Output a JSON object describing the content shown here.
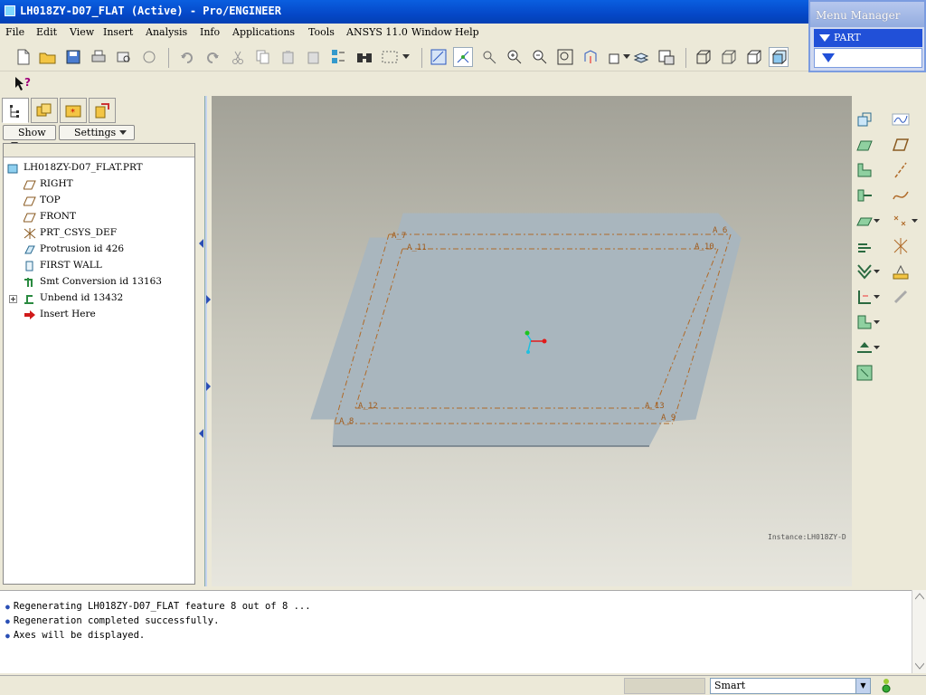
{
  "window": {
    "title": "LH018ZY-D07_FLAT (Active) - Pro/ENGINEER"
  },
  "menubar": {
    "items": [
      "File",
      "Edit",
      "View",
      "Insert",
      "Analysis",
      "Info",
      "Applications",
      "Tools",
      "ANSYS 11.0",
      "Window",
      "Help"
    ]
  },
  "menu_manager": {
    "title": "Menu Manager",
    "part_label": "PART"
  },
  "left_panel": {
    "show_label": "Show",
    "settings_label": "Settings",
    "tree": [
      {
        "label": "LH018ZY-D07_FLAT.PRT",
        "icon": "part-icon"
      },
      {
        "label": "RIGHT",
        "icon": "datum-plane-icon"
      },
      {
        "label": "TOP",
        "icon": "datum-plane-icon"
      },
      {
        "label": "FRONT",
        "icon": "datum-plane-icon"
      },
      {
        "label": "PRT_CSYS_DEF",
        "icon": "csys-icon"
      },
      {
        "label": "Protrusion id 426",
        "icon": "protrusion-icon"
      },
      {
        "label": "FIRST WALL",
        "icon": "wall-icon"
      },
      {
        "label": "Smt Conversion id 13163",
        "icon": "smt-conversion-icon"
      },
      {
        "label": "Unbend id 13432",
        "icon": "unbend-icon"
      },
      {
        "label": "Insert Here",
        "icon": "insert-arrow-icon"
      }
    ]
  },
  "viewport": {
    "axis_labels": [
      "A_7",
      "A_11",
      "A_6",
      "A_10",
      "A_12",
      "A_8",
      "A_13",
      "A_9"
    ],
    "instance_text": "Instance:LH018ZY-D",
    "colors": {
      "sheet_fill": "#a9b6be",
      "sheet_edge": "#7f8d96",
      "axis_line": "#b06a28",
      "csys_red": "#e11b1b",
      "csys_green": "#1ec41e",
      "csys_cyan": "#1ec0e0"
    }
  },
  "messages": [
    "Regenerating LH018ZY-D07_FLAT feature 8 out of 8 ...",
    "Regeneration completed successfully.",
    "Axes will be displayed."
  ],
  "status": {
    "filter_value": "Smart"
  }
}
